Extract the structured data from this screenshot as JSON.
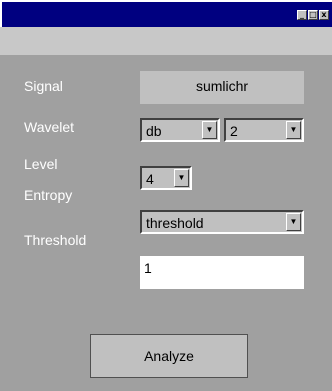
{
  "window": {
    "controls": {
      "minimize": "_",
      "maximize": "□",
      "close": "x"
    }
  },
  "form": {
    "signal": {
      "label": "Signal",
      "value": "sumlichr"
    },
    "wavelet": {
      "label": "Wavelet",
      "family": "db",
      "order": "2"
    },
    "level": {
      "label": "Level",
      "value": "4"
    },
    "entropy": {
      "label": "Entropy",
      "value": "threshold"
    },
    "threshold": {
      "label": "Threshold",
      "value": "1"
    }
  },
  "actions": {
    "analyze_label": "Analyze"
  },
  "icons": {
    "dropdown_arrow": "▼"
  },
  "colors": {
    "titlebar": "#000080",
    "panel": "#a0a0a0",
    "control": "#c0c0c0"
  }
}
